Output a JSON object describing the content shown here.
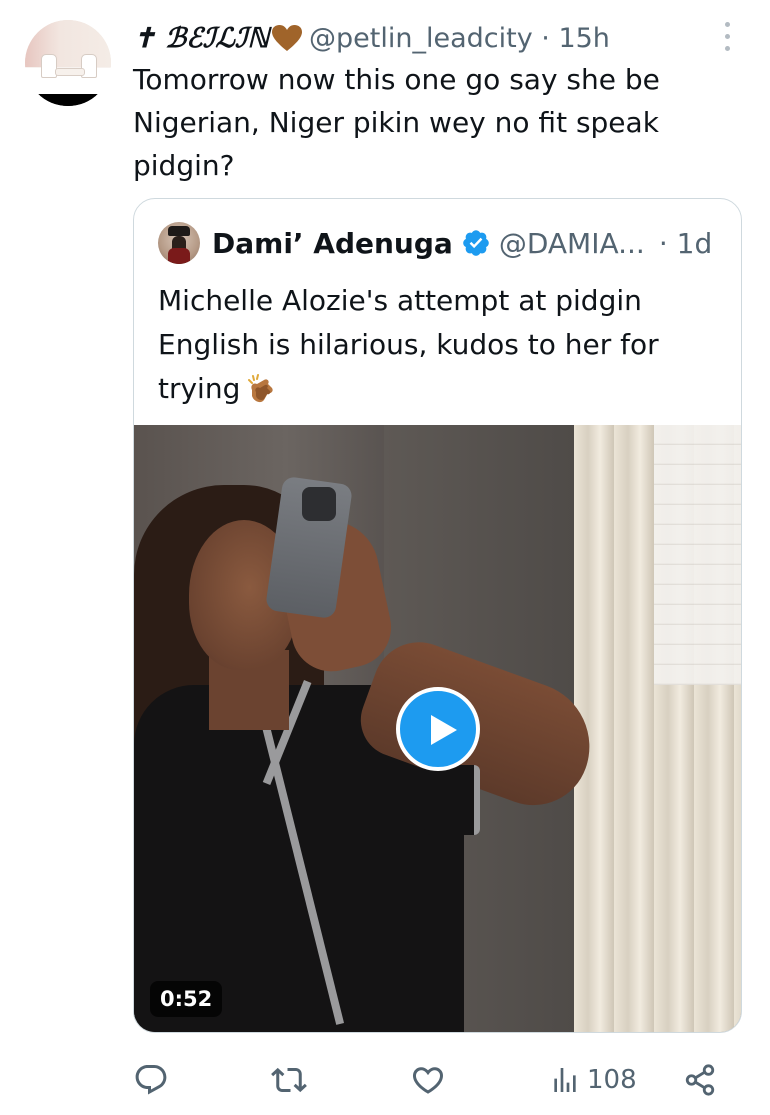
{
  "tweet": {
    "author": {
      "display_name": "✝ ℬℰℐℒℐℕ",
      "handle_time": "@petlin_leadcity · 15h"
    },
    "text": "Tomorrow now this one go say she be\nNigerian, Niger pikin wey no fit speak\npidgin?",
    "more_icon": "more-vertical-icon"
  },
  "quote": {
    "author": {
      "display_name": "Dami’ Adenuga",
      "handle": "@DAMIA...",
      "time": "· 1d",
      "verified": true
    },
    "text": "Michelle Alozie's attempt at pidgin English is hilarious, kudos to her for trying",
    "emoji": "clapping-hands-icon",
    "video": {
      "duration": "0:52",
      "play_icon": "play-icon"
    }
  },
  "actions": {
    "reply_icon": "reply-icon",
    "retweet_icon": "retweet-icon",
    "like_icon": "heart-icon",
    "views_icon": "views-chart-icon",
    "views_count": "108",
    "share_icon": "share-icon"
  },
  "colors": {
    "accent": "#1d9bf0",
    "secondary_text": "#536471",
    "border": "#cfd9de",
    "heart_emoji": "#a0642a"
  }
}
